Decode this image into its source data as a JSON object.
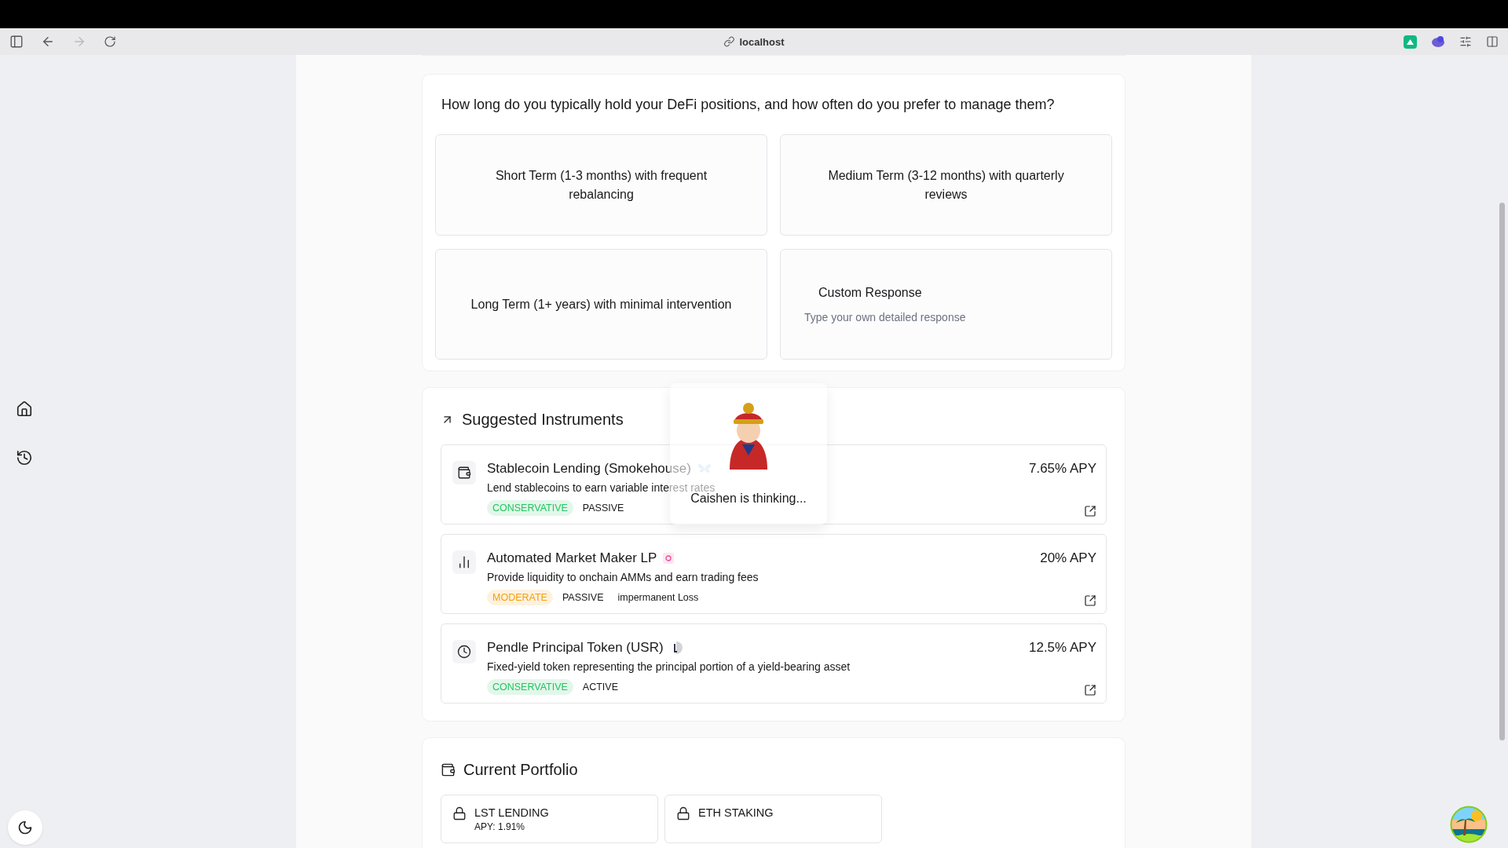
{
  "browser": {
    "address": "localhost",
    "forward_disabled": true
  },
  "question_card": {
    "question": "How long do you typically hold your DeFi positions, and how often do you prefer to manage them?",
    "options": [
      {
        "kind": "preset",
        "text": "Short Term (1-3 months) with frequent rebalancing",
        "selected": false
      },
      {
        "kind": "preset",
        "text": "Medium Term (3-12 months) with quarterly reviews",
        "selected": false
      },
      {
        "kind": "preset",
        "text": "Long Term (1+ years) with minimal intervention",
        "selected": false
      },
      {
        "kind": "custom",
        "title": "Custom Response",
        "placeholder": "Type your own detailed response",
        "selected": false
      }
    ]
  },
  "thinking_popup": {
    "text": "Caishen is thinking..."
  },
  "suggested_instruments": {
    "title": "Suggested Instruments",
    "items": [
      {
        "name": "Stablecoin Lending (Smokehouse)",
        "description": "Lend stablecoins to earn variable interest rates",
        "apy": "7.65% APY",
        "tags": [
          {
            "text": "CONSERVATIVE",
            "kind": "risk",
            "color": "#22c55e"
          },
          {
            "text": "PASSIVE",
            "kind": "plain"
          }
        ]
      },
      {
        "name": "Automated Market Maker LP",
        "description": "Provide liquidity to onchain AMMs and earn trading fees",
        "apy": "20% APY",
        "tags": [
          {
            "text": "MODERATE",
            "kind": "risk",
            "color": "#f59e0b"
          },
          {
            "text": "PASSIVE",
            "kind": "plain"
          },
          {
            "text": "impermanent Loss",
            "kind": "plain"
          }
        ]
      },
      {
        "name": "Pendle Principal Token (USR)",
        "description": "Fixed-yield token representing the principal portion of a yield-bearing asset",
        "apy": "12.5% APY",
        "tags": [
          {
            "text": "CONSERVATIVE",
            "kind": "risk",
            "color": "#22c55e"
          },
          {
            "text": "ACTIVE",
            "kind": "plain"
          }
        ]
      }
    ]
  },
  "current_portfolio": {
    "title": "Current Portfolio",
    "items": [
      {
        "name": "LST LENDING",
        "apy": "APY: 1.91%"
      },
      {
        "name": "ETH STAKING"
      }
    ]
  }
}
